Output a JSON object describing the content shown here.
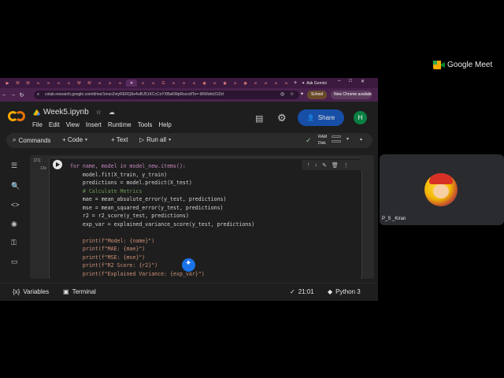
{
  "browser": {
    "new_tab_symbol": "+",
    "ask_gemini": "Ask Gemini",
    "url": "colab.research.google.com/drive/1mso2vtyRERQ6e4ufIU51KCcCoYXBaKMpRscrollTo=-96Wdnk31Dd",
    "profile_label": "School",
    "update_label": "New Chrome available"
  },
  "meet": {
    "app_name": "Google Meet",
    "participant_name": "P_S _Kiran"
  },
  "colab": {
    "notebook_name": "Week5.ipynb",
    "menu": [
      "File",
      "Edit",
      "View",
      "Insert",
      "Runtime",
      "Tools",
      "Help"
    ],
    "share_label": "Share",
    "user_initial": "H",
    "toolbar": {
      "commands": "Commands",
      "code": "+ Code",
      "text": "+ Text",
      "run_all": "Run all",
      "ram": "RAM",
      "disk": "Disk"
    },
    "cell": {
      "exec_count": "[21]",
      "exec_time": "13s",
      "code_lines": [
        "for name, model in model_new.items():",
        "    model.fit(X_train, y_train)",
        "    predictions = model.predict(X_test)",
        "    # Calculate Metrics",
        "    mae = mean_absolute_error(y_test, predictions)",
        "    mse = mean_squared_error(y_test, predictions)",
        "    r2 = r2_score(y_test, predictions)",
        "    exp_var = explained_variance_score(y_test, predictions)",
        "",
        "    print(f\"Model: {name}\")",
        "    print(f\"MAE: {mae}\")",
        "    print(f\"MSE: {mse}\")",
        "    print(f\"R2 Score: {r2}\")",
        "    print(f\"Explained Variance: {exp_var}\")"
      ]
    },
    "statusbar": {
      "variables": "Variables",
      "terminal": "Terminal",
      "time": "21:01",
      "python": "Python 3"
    }
  }
}
